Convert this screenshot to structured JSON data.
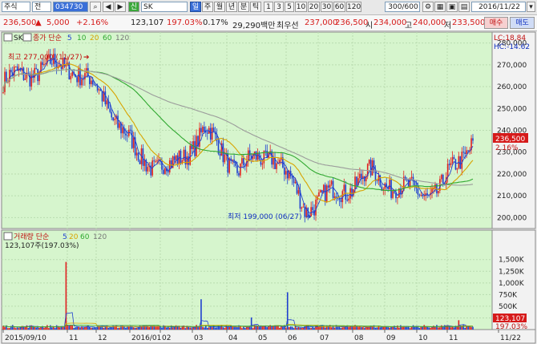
{
  "toolbar": {
    "market": "주식",
    "mode": "전",
    "code": "034730",
    "credit_badge": "신",
    "name": "SK",
    "periods": [
      "일",
      "주",
      "월",
      "년",
      "분",
      "틱"
    ],
    "active_period": "일",
    "intervals": [
      "1",
      "3",
      "5",
      "10",
      "20",
      "30",
      "60",
      "120"
    ],
    "count": "300/600",
    "date": "2016/11/22"
  },
  "quote": {
    "price": "236,500",
    "arrow": "▲",
    "change": "5,000",
    "change_pct": "+2.16%",
    "volume": "123,107",
    "vol_ratio": "197.03%",
    "turnover": "0.17%",
    "amount": "29,290백만",
    "pref_label": "최우선",
    "ask": "237,000",
    "bid": "236,500",
    "open_label": "시",
    "open": "234,000",
    "high_label": "고",
    "high": "240,000",
    "low_label": "저",
    "low": "233,500",
    "buy": "매수",
    "sell": "매도"
  },
  "price_panel": {
    "legend_name": "SK",
    "legend_label": "종가 단순",
    "ma": [
      {
        "period": "5",
        "color": "#1f3fd0"
      },
      {
        "period": "10",
        "color": "#2fa82f"
      },
      {
        "period": "20",
        "color": "#d8a300"
      },
      {
        "period": "60",
        "color": "#2fa82f"
      },
      {
        "period": "120",
        "color": "#9b9b9b"
      }
    ],
    "lc": "LC:18.84",
    "hc": "HC:-14.62",
    "high_note": "최고 277,000 (11/27)",
    "low_note": "최저 199,000 (06/27)",
    "current_price": "236,500",
    "current_pct": "2.16%"
  },
  "volume_panel": {
    "legend_label": "거래량 단순",
    "ma": [
      "5",
      "20",
      "60",
      "120"
    ],
    "value_text": "123,107주(197.03%)",
    "current_volume": "123,107",
    "current_pct": "197.03%"
  },
  "chart_data": {
    "type": "line",
    "title": "",
    "price_axis": {
      "min": 195000,
      "max": 285000,
      "ticks": [
        200000,
        210000,
        220000,
        230000,
        240000,
        250000,
        260000,
        270000,
        280000
      ],
      "tick_labels": [
        "200,000",
        "210,000",
        "220,000",
        "230,000",
        "240,000",
        "250,000",
        "260,000",
        "270,000",
        "280,000"
      ]
    },
    "volume_axis": {
      "max": 1650000,
      "ticks": [
        250000,
        500000,
        750000,
        1000000,
        1250000,
        1500000
      ],
      "tick_labels": [
        "250K",
        "500K",
        "750K",
        "1,000K",
        "1,250K",
        "1,500K"
      ]
    },
    "x_labels": [
      "2015/09/10",
      "11",
      "12",
      "2016/01",
      "02",
      "03",
      "04",
      "05",
      "06",
      "07",
      "08",
      "09",
      "10",
      "11",
      "11/22"
    ],
    "close_series": [
      {
        "month": "2015-09",
        "close": 262000
      },
      {
        "month": "2015-10",
        "close": 268000
      },
      {
        "month": "2015-11",
        "close": 270000
      },
      {
        "month": "2015-12",
        "close": 255000
      },
      {
        "month": "2016-01",
        "close": 228000
      },
      {
        "month": "2016-02",
        "close": 222000
      },
      {
        "month": "2016-03",
        "close": 240000
      },
      {
        "month": "2016-04",
        "close": 222000
      },
      {
        "month": "2016-05",
        "close": 230000
      },
      {
        "month": "2016-06",
        "close": 205000
      },
      {
        "month": "2016-07",
        "close": 212000
      },
      {
        "month": "2016-08",
        "close": 220000
      },
      {
        "month": "2016-09",
        "close": 212000
      },
      {
        "month": "2016-10",
        "close": 212000
      },
      {
        "month": "2016-11",
        "close": 236500
      }
    ],
    "annotations": [
      {
        "text": "최고 277,000 (11/27)",
        "value": 277000
      },
      {
        "text": "최저 199,000 (06/27)",
        "value": 199000
      }
    ]
  }
}
